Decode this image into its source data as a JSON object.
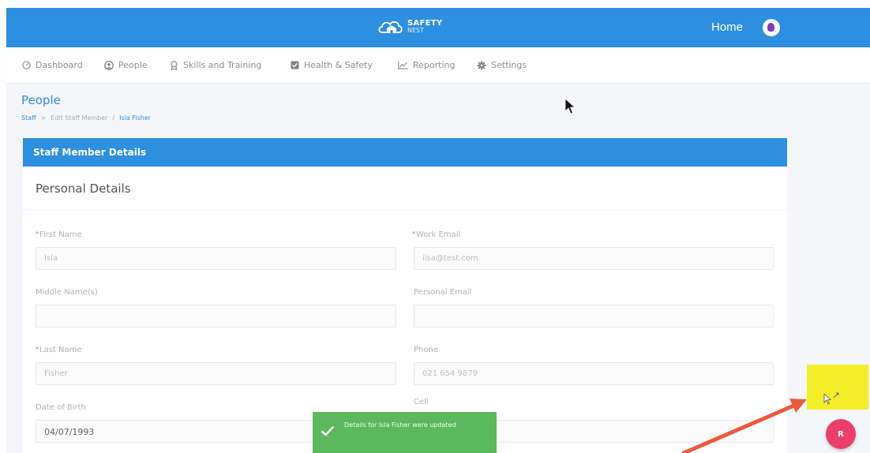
{
  "brand": {
    "line1": "SAFETY",
    "line2": "NEST",
    "logo_icon": "cloud-house-icon"
  },
  "header": {
    "home_label": "Home",
    "avatar_icon": "user-avatar-icon"
  },
  "nav": {
    "items": [
      {
        "label": "Dashboard",
        "icon": "dashboard-icon"
      },
      {
        "label": "People",
        "icon": "person-icon"
      },
      {
        "label": "Skills and Training",
        "icon": "award-icon"
      },
      {
        "label": "Health & Safety",
        "icon": "checkbox-icon"
      },
      {
        "label": "Reporting",
        "icon": "line-chart-icon"
      },
      {
        "label": "Settings",
        "icon": "gear-icon"
      }
    ]
  },
  "page": {
    "title": "People",
    "breadcrumb": [
      "Staff",
      ">",
      "Edit Staff Member",
      "/",
      "Isla Fisher"
    ]
  },
  "card": {
    "header": "Staff Member Details",
    "section_title": "Personal Details"
  },
  "form": {
    "first_name": {
      "label": "First Name",
      "required_mark": "*",
      "value": "Isla"
    },
    "work_email": {
      "label": "Work Email",
      "required_mark": "*",
      "value": "ilsa@test.com"
    },
    "middle_names": {
      "label": "Middle Name(s)",
      "value": ""
    },
    "personal_email": {
      "label": "Personal Email",
      "value": ""
    },
    "last_name": {
      "label": "Last Name",
      "required_mark": "*",
      "value": "Fisher"
    },
    "phone": {
      "label": "Phone",
      "value": "021 654 9879"
    },
    "dob": {
      "label": "Date of Birth",
      "value": "04/07/1993"
    },
    "cell": {
      "label": "Cell",
      "value": ""
    }
  },
  "toast": {
    "message": "Details for Isla Fisher were updated",
    "icon": "check-icon"
  },
  "fab": {
    "label": "R"
  },
  "annotation": {
    "highlight_color": "#f4ee2b",
    "arrow_color": "#ee5a3c"
  },
  "colors": {
    "primary": "#2d8fdf",
    "success": "#5cb85c",
    "fab": "#ea3f6b"
  }
}
